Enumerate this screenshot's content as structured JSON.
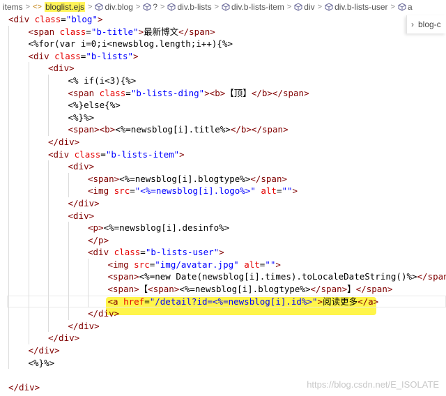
{
  "breadcrumb": {
    "items": [
      {
        "label": "items",
        "icon": "none"
      },
      {
        "label": "bloglist.ejs",
        "icon": "ejs-file-icon",
        "highlight": true
      },
      {
        "label": "div.blog",
        "icon": "element-icon"
      },
      {
        "label": "?",
        "icon": "element-icon"
      },
      {
        "label": "div.b-lists",
        "icon": "element-icon"
      },
      {
        "label": "div.b-lists-item",
        "icon": "element-icon"
      },
      {
        "label": "div",
        "icon": "element-icon"
      },
      {
        "label": "div.b-lists-user",
        "icon": "element-icon"
      },
      {
        "label": "a",
        "icon": "element-icon"
      }
    ],
    "separator": ">",
    "file_prefix": "<>"
  },
  "side_tab": {
    "label": "blog-c"
  },
  "code": [
    {
      "indent": 0,
      "tokens": [
        [
          "tag",
          "<div "
        ],
        [
          "attr",
          "class"
        ],
        [
          "txt",
          "="
        ],
        [
          "str",
          "\"blog\""
        ],
        [
          "tag",
          ">"
        ]
      ]
    },
    {
      "indent": 1,
      "tokens": [
        [
          "tag",
          "<span "
        ],
        [
          "attr",
          "class"
        ],
        [
          "txt",
          "="
        ],
        [
          "str",
          "\"b-title\""
        ],
        [
          "tag",
          ">"
        ],
        [
          "txt",
          "最新博文"
        ],
        [
          "tag",
          "</span>"
        ]
      ]
    },
    {
      "indent": 1,
      "tokens": [
        [
          "txt",
          "<%for(var i=0;i<newsblog.length;i++){%>"
        ]
      ]
    },
    {
      "indent": 1,
      "tokens": [
        [
          "tag",
          "<div "
        ],
        [
          "attr",
          "class"
        ],
        [
          "txt",
          "="
        ],
        [
          "str",
          "\"b-lists\""
        ],
        [
          "tag",
          ">"
        ]
      ]
    },
    {
      "indent": 2,
      "tokens": [
        [
          "tag",
          "<div>"
        ]
      ]
    },
    {
      "indent": 3,
      "tokens": [
        [
          "txt",
          "<% if(i<3){%>"
        ]
      ]
    },
    {
      "indent": 3,
      "tokens": [
        [
          "tag",
          "<span "
        ],
        [
          "attr",
          "class"
        ],
        [
          "txt",
          "="
        ],
        [
          "str",
          "\"b-lists-ding\""
        ],
        [
          "tag",
          ">"
        ],
        [
          "tag",
          "<b>"
        ],
        [
          "txt",
          "【顶】"
        ],
        [
          "tag",
          "</b></span>"
        ]
      ]
    },
    {
      "indent": 3,
      "tokens": [
        [
          "txt",
          "<%}else{%>"
        ]
      ]
    },
    {
      "indent": 3,
      "tokens": [
        [
          "txt",
          "<%}%>"
        ]
      ]
    },
    {
      "indent": 3,
      "tokens": [
        [
          "tag",
          "<span><b>"
        ],
        [
          "txt",
          "<%=newsblog[i].title%>"
        ],
        [
          "tag",
          "</b></span>"
        ]
      ]
    },
    {
      "indent": 2,
      "tokens": [
        [
          "tag",
          "</div>"
        ]
      ]
    },
    {
      "indent": 2,
      "tokens": [
        [
          "tag",
          "<div "
        ],
        [
          "attr",
          "class"
        ],
        [
          "txt",
          "="
        ],
        [
          "str",
          "\"b-lists-item\""
        ],
        [
          "tag",
          ">"
        ]
      ]
    },
    {
      "indent": 3,
      "tokens": [
        [
          "tag",
          "<div>"
        ]
      ]
    },
    {
      "indent": 4,
      "tokens": [
        [
          "tag",
          "<span>"
        ],
        [
          "txt",
          "<%=newsblog[i].blogtype%>"
        ],
        [
          "tag",
          "</span>"
        ]
      ]
    },
    {
      "indent": 4,
      "tokens": [
        [
          "tag",
          "<img "
        ],
        [
          "attr",
          "src"
        ],
        [
          "txt",
          "="
        ],
        [
          "str",
          "\"<%=newsblog[i].logo%>\""
        ],
        [
          "txt",
          " "
        ],
        [
          "attr",
          "alt"
        ],
        [
          "txt",
          "="
        ],
        [
          "str",
          "\"\""
        ],
        [
          "tag",
          ">"
        ]
      ]
    },
    {
      "indent": 3,
      "tokens": [
        [
          "tag",
          "</div>"
        ]
      ]
    },
    {
      "indent": 3,
      "tokens": [
        [
          "tag",
          "<div>"
        ]
      ]
    },
    {
      "indent": 4,
      "tokens": [
        [
          "tag",
          "<p>"
        ],
        [
          "txt",
          "<%=newsblog[i].desinfo%>"
        ]
      ]
    },
    {
      "indent": 4,
      "tokens": [
        [
          "tag",
          "</p>"
        ]
      ]
    },
    {
      "indent": 4,
      "tokens": [
        [
          "tag",
          "<div "
        ],
        [
          "attr",
          "class"
        ],
        [
          "txt",
          "="
        ],
        [
          "str",
          "\"b-lists-user\""
        ],
        [
          "tag",
          ">"
        ]
      ]
    },
    {
      "indent": 5,
      "tokens": [
        [
          "tag",
          "<img "
        ],
        [
          "attr",
          "src"
        ],
        [
          "txt",
          "="
        ],
        [
          "str",
          "\"img/avatar.jpg\""
        ],
        [
          "txt",
          " "
        ],
        [
          "attr",
          "alt"
        ],
        [
          "txt",
          "="
        ],
        [
          "str",
          "\"\""
        ],
        [
          "tag",
          ">"
        ]
      ]
    },
    {
      "indent": 5,
      "tokens": [
        [
          "tag",
          "<span>"
        ],
        [
          "txt",
          "<%=new Date(newsblog[i].times).toLocaleDateString()%>"
        ],
        [
          "tag",
          "</span>"
        ]
      ]
    },
    {
      "indent": 5,
      "tokens": [
        [
          "tag",
          "<span>"
        ],
        [
          "txt",
          "【"
        ],
        [
          "tag",
          "<span>"
        ],
        [
          "txt",
          "<%=newsblog[i].blogtype%>"
        ],
        [
          "tag",
          "</span>"
        ],
        [
          "txt",
          "】"
        ],
        [
          "tag",
          "</span>"
        ]
      ]
    },
    {
      "indent": 5,
      "tokens": [
        [
          "tag",
          "<a "
        ],
        [
          "attr",
          "href"
        ],
        [
          "txt",
          "="
        ],
        [
          "str",
          "\"/detail?id=<%=newsblog[i].id%>\""
        ],
        [
          "tag",
          ">"
        ],
        [
          "txt",
          "阅读更多"
        ],
        [
          "tag",
          "</a>"
        ]
      ],
      "current": true
    },
    {
      "indent": 4,
      "tokens": [
        [
          "tag",
          "</div>"
        ]
      ]
    },
    {
      "indent": 3,
      "tokens": [
        [
          "tag",
          "</div>"
        ]
      ]
    },
    {
      "indent": 2,
      "tokens": [
        [
          "tag",
          "</div>"
        ]
      ]
    },
    {
      "indent": 1,
      "tokens": [
        [
          "tag",
          "</div>"
        ]
      ]
    },
    {
      "indent": 1,
      "tokens": [
        [
          "txt",
          "<%}%>"
        ]
      ]
    },
    {
      "indent": 0,
      "tokens": [
        [
          "txt",
          ""
        ]
      ]
    },
    {
      "indent": 0,
      "tokens": [
        [
          "tag",
          "</div>"
        ]
      ]
    }
  ],
  "watermark": "https://blog.csdn.net/E_ISOLATE",
  "colors": {
    "tag": "#800000",
    "attr": "#e50000",
    "string": "#0000ff",
    "highlight": "#fff54a"
  }
}
